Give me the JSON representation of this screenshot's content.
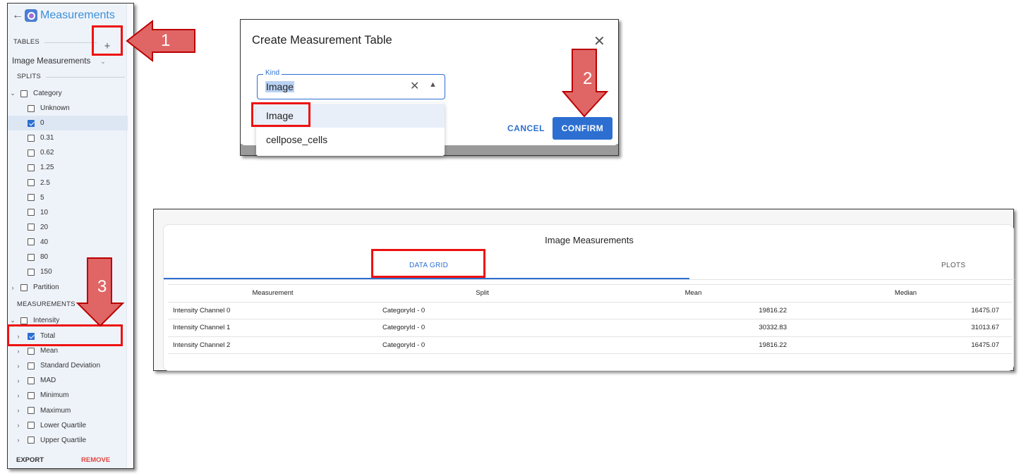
{
  "sidebar": {
    "back_icon": "arrow-left-icon",
    "app_icon": "app-logo-icon",
    "title": "Measurements",
    "tables_label": "TABLES",
    "add_icon": "plus-icon",
    "table_name": "Image Measurements",
    "splits_label": "SPLITS",
    "category_label": "Category",
    "category_items": [
      {
        "label": "Unknown",
        "checked": false
      },
      {
        "label": "0",
        "checked": true
      },
      {
        "label": "0.31",
        "checked": false
      },
      {
        "label": "0.62",
        "checked": false
      },
      {
        "label": "1.25",
        "checked": false
      },
      {
        "label": "2.5",
        "checked": false
      },
      {
        "label": "5",
        "checked": false
      },
      {
        "label": "10",
        "checked": false
      },
      {
        "label": "20",
        "checked": false
      },
      {
        "label": "40",
        "checked": false
      },
      {
        "label": "80",
        "checked": false
      },
      {
        "label": "150",
        "checked": false
      }
    ],
    "partition_label": "Partition",
    "measurements_label": "MEASUREMENTS",
    "intensity_label": "Intensity",
    "intensity_items": [
      {
        "label": "Total",
        "checked": true
      },
      {
        "label": "Mean",
        "checked": false
      },
      {
        "label": "Standard Deviation",
        "checked": false
      },
      {
        "label": "MAD",
        "checked": false
      },
      {
        "label": "Minimum",
        "checked": false
      },
      {
        "label": "Maximum",
        "checked": false
      },
      {
        "label": "Lower Quartile",
        "checked": false
      },
      {
        "label": "Upper Quartile",
        "checked": false
      }
    ],
    "export_label": "EXPORT",
    "remove_label": "REMOVE"
  },
  "dialog": {
    "title": "Create Measurement Table",
    "kind_label": "Kind",
    "kind_value": "Image",
    "options": [
      "Image",
      "cellpose_cells"
    ],
    "cancel_label": "CANCEL",
    "confirm_label": "CONFIRM"
  },
  "grid": {
    "title": "Image Measurements",
    "tabs": [
      "DATA GRID",
      "PLOTS"
    ],
    "columns": [
      "Measurement",
      "Split",
      "Mean",
      "Median"
    ],
    "rows": [
      [
        "Intensity Channel 0",
        "CategoryId - 0",
        "19816.22",
        "16475.07"
      ],
      [
        "Intensity Channel 1",
        "CategoryId - 0",
        "30332.83",
        "31013.67"
      ],
      [
        "Intensity Channel 2",
        "CategoryId - 0",
        "19816.22",
        "16475.07"
      ]
    ]
  },
  "annotations": {
    "step_numbers": [
      "1",
      "2",
      "3"
    ],
    "highlight_color": "#e11111",
    "arrow_fill": "#e06666"
  }
}
